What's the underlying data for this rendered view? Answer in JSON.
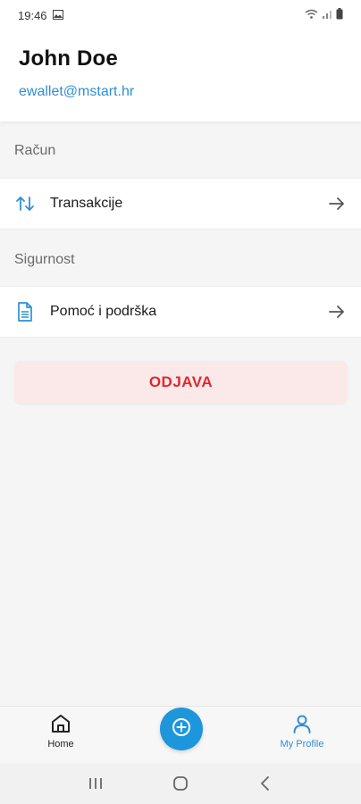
{
  "status_bar": {
    "time": "19:46",
    "icons": [
      "image-icon",
      "wifi-icon",
      "signal-icon",
      "battery-icon"
    ]
  },
  "profile": {
    "name": "John Doe",
    "email": "ewallet@mstart.hr"
  },
  "sections": [
    {
      "label": "Račun",
      "items": [
        {
          "label": "Transakcije",
          "icon": "transfer-arrows-icon"
        }
      ]
    },
    {
      "label": "Sigurnost",
      "items": [
        {
          "label": "Pomoć i podrška",
          "icon": "document-icon"
        }
      ]
    }
  ],
  "logout": {
    "label": "ODJAVA"
  },
  "bottom_nav": {
    "home": {
      "label": "Home",
      "icon": "home-icon"
    },
    "add": {
      "icon": "plus-circle-icon"
    },
    "profile": {
      "label": "My Profile",
      "icon": "user-icon",
      "active": true
    }
  },
  "colors": {
    "accent": "#2f8fd6",
    "fab": "#1e96dc",
    "logout_text": "#e0282f",
    "logout_bg": "#fbe9ea"
  }
}
